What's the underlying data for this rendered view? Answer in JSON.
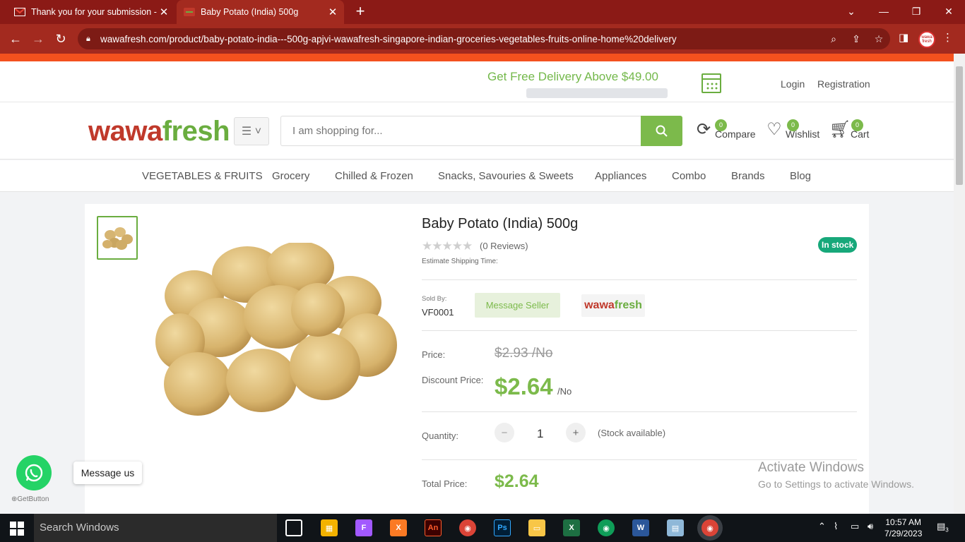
{
  "browser": {
    "tabs": [
      {
        "title": "Thank you for your submission -"
      },
      {
        "title": "Baby Potato (India) 500g"
      }
    ],
    "url": "wawafresh.com/product/baby-potato-india---500g-apjvi-wawafresh-singapore-indian-groceries-vegetables-fruits-online-home%20delivery",
    "profile_text": "wawa fresh"
  },
  "topbar": {
    "free_delivery": "Get Free Delivery Above $49.00",
    "login": "Login",
    "registration": "Registration"
  },
  "header": {
    "logo_a": "wawa",
    "logo_b": "fresh",
    "search_placeholder": "I am shopping for...",
    "compare": {
      "label": "Compare",
      "count": "0"
    },
    "wishlist": {
      "label": "Wishlist",
      "count": "0"
    },
    "cart": {
      "label": "Cart",
      "count": "0"
    }
  },
  "categories": [
    "VEGETABLES & FRUITS",
    "Grocery",
    "Chilled & Frozen",
    "Snacks, Savouries & Sweets",
    "Appliances",
    "Combo",
    "Brands",
    "Blog"
  ],
  "product": {
    "title": "Baby Potato (India) 500g",
    "stars": "★★★★★",
    "reviews": "(0 Reviews)",
    "stock_badge": "In stock",
    "shipping_label": "Estimate Shipping Time:",
    "sold_by_label": "Sold By:",
    "seller_id": "VF0001",
    "message_seller": "Message Seller",
    "seller_logo_a": "wawa",
    "seller_logo_b": "fresh",
    "price_label": "Price:",
    "old_price": "$2.93 /No",
    "discount_label": "Discount Price:",
    "discount_price": "$2.64",
    "unit": "/No",
    "quantity_label": "Quantity:",
    "quantity": "1",
    "stock_note": "(Stock available)",
    "total_label": "Total Price:",
    "total_price": "$2.64"
  },
  "whatsapp": {
    "message": "Message us",
    "powered_by": "GetButton"
  },
  "windows": {
    "activate_title": "Activate Windows",
    "activate_sub": "Go to Settings to activate Windows.",
    "search": "Search Windows",
    "time": "10:57 AM",
    "date": "7/29/2023",
    "notif_count": "3"
  },
  "colors": {
    "brand_green": "#7cba4b",
    "brand_red": "#c0392b",
    "chrome": "#a32a1f"
  }
}
